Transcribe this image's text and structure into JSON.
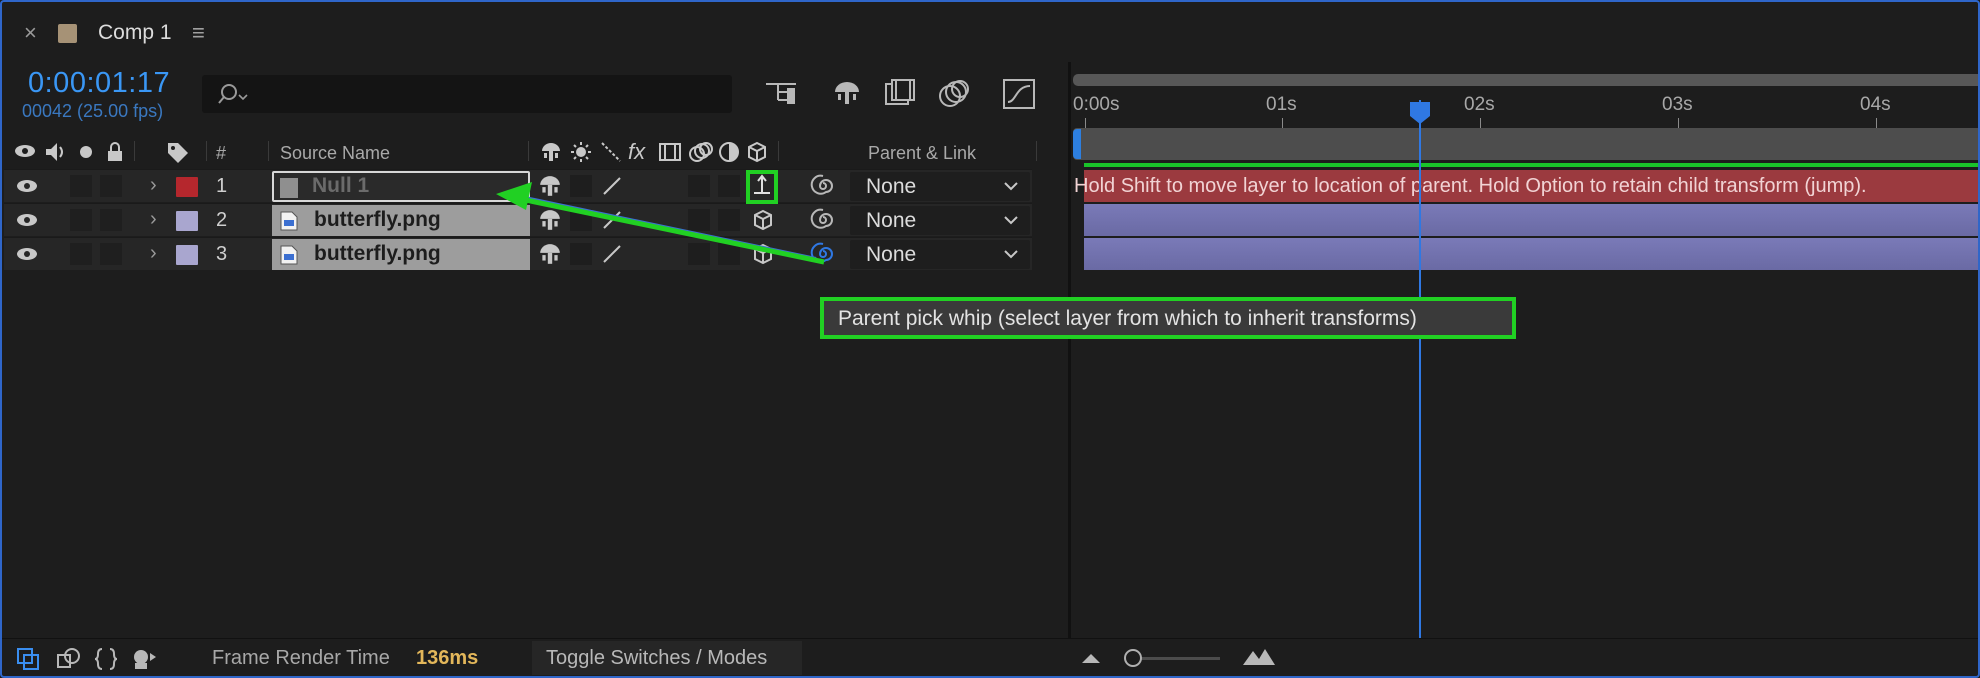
{
  "panel": {
    "close_glyph": "×",
    "swatch_color": "#a69276",
    "title": "Comp 1",
    "menu_glyph": "≡"
  },
  "header": {
    "timecode": "0:00:01:17",
    "frames": "00042 (25.00 fps)",
    "search_placeholder": "",
    "timecode_color": "#3a97f5",
    "icons": [
      "composition-flowchart-icon",
      "draft-3d-icon",
      "frame-blending-icon",
      "motion-blur-icon",
      "graph-editor-icon"
    ]
  },
  "columns": {
    "number": "#",
    "source_name": "Source Name",
    "fx": "fx",
    "parent_link": "Parent & Link"
  },
  "layers": [
    {
      "number": "1",
      "name": "Null 1",
      "label_color": "#b5272d",
      "parent": "None",
      "type": "null",
      "selected": true
    },
    {
      "number": "2",
      "name": "butterfly.png",
      "label_color": "#a9a6cf",
      "parent": "None",
      "type": "footage",
      "selected": false
    },
    {
      "number": "3",
      "name": "butterfly.png",
      "label_color": "#a9a6cf",
      "parent": "None",
      "type": "footage",
      "selected": false
    }
  ],
  "timeline": {
    "ticks": [
      "0:00s",
      "01s",
      "02s",
      "03s",
      "04s"
    ],
    "track_message": "Hold Shift to move layer to location of parent. Hold Option to retain child transform (jump).",
    "cti_color": "#2f78e3",
    "work_area_color": "#19c42a"
  },
  "tooltip": {
    "text": "Parent pick whip (select layer from which to inherit transforms)"
  },
  "annotation_color": "#21d023",
  "footer": {
    "render_label": "Frame Render Time",
    "render_value": "136ms",
    "toggle_label": "Toggle Switches / Modes"
  }
}
